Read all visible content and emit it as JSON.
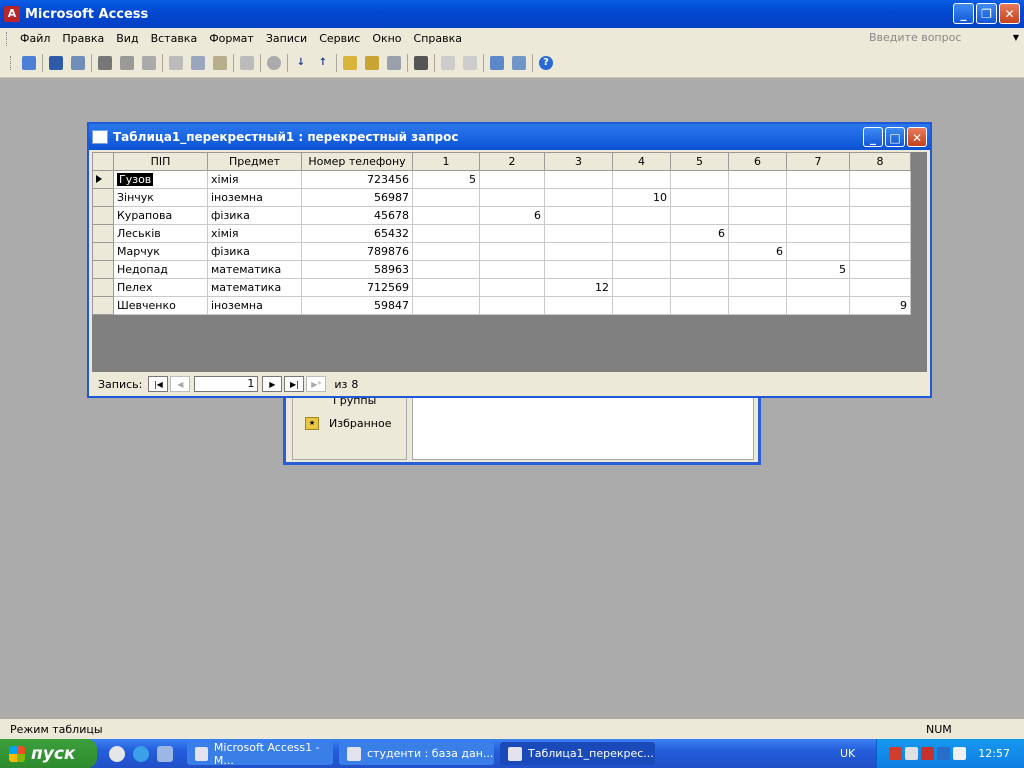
{
  "app": {
    "title": "Microsoft Access"
  },
  "menu": {
    "items": [
      "Файл",
      "Правка",
      "Вид",
      "Вставка",
      "Формат",
      "Записи",
      "Сервис",
      "Окно",
      "Справка"
    ],
    "search_placeholder": "Введите вопрос"
  },
  "toolbar": {
    "icons": [
      "design-view-icon",
      "save-icon",
      "search-icon",
      "print-icon",
      "print-preview-icon",
      "spelling-icon",
      "cut-icon",
      "copy-icon",
      "paste-icon",
      "undo-icon",
      "hyperlink-icon",
      "sort-ascending-icon",
      "sort-descending-icon",
      "filter-selection-icon",
      "filter-form-icon",
      "apply-filter-icon",
      "find-icon",
      "new-record-icon",
      "delete-record-icon",
      "database-window-icon",
      "new-object-icon",
      "help-icon"
    ]
  },
  "dbwindow": {
    "groups_label": "Группы",
    "favorites_label": "Избранное"
  },
  "query_window": {
    "title": "Таблица1_перекрестный1 : перекрестный запрос",
    "columns": [
      "ПІП",
      "Предмет",
      "Номер телефону",
      "1",
      "2",
      "3",
      "4",
      "5",
      "6",
      "7",
      "8"
    ],
    "rows": [
      {
        "name": "Гузов",
        "subject": "хімія",
        "phone": "723456",
        "scores": [
          "5",
          "",
          "",
          "",
          "",
          "",
          "",
          ""
        ]
      },
      {
        "name": "Зінчук",
        "subject": "іноземна",
        "phone": "56987",
        "scores": [
          "",
          "",
          "",
          "10",
          "",
          "",
          "",
          ""
        ]
      },
      {
        "name": "Курапова",
        "subject": "фізика",
        "phone": "45678",
        "scores": [
          "",
          "6",
          "",
          "",
          "",
          "",
          "",
          ""
        ]
      },
      {
        "name": "Леськів",
        "subject": "хімія",
        "phone": "65432",
        "scores": [
          "",
          "",
          "",
          "",
          "6",
          "",
          "",
          ""
        ]
      },
      {
        "name": "Марчук",
        "subject": "фізика",
        "phone": "789876",
        "scores": [
          "",
          "",
          "",
          "",
          "",
          "6",
          "",
          ""
        ]
      },
      {
        "name": "Недопад",
        "subject": "математика",
        "phone": "58963",
        "scores": [
          "",
          "",
          "",
          "",
          "",
          "",
          "5",
          ""
        ]
      },
      {
        "name": "Пелех",
        "subject": "математика",
        "phone": "712569",
        "scores": [
          "",
          "",
          "12",
          "",
          "",
          "",
          "",
          ""
        ]
      },
      {
        "name": "Шевченко",
        "subject": "іноземна",
        "phone": "59847",
        "scores": [
          "",
          "",
          "",
          "",
          "",
          "",
          "",
          "9"
        ]
      }
    ],
    "nav": {
      "label": "Запись:",
      "current": "1",
      "of_label": "из",
      "total": "8"
    }
  },
  "status": {
    "mode": "Режим таблицы",
    "num": "NUM"
  },
  "taskbar": {
    "start": "пуск",
    "buttons": [
      {
        "label": "Microsoft Access1 - М...",
        "active": false
      },
      {
        "label": "студенти : база дан...",
        "active": false
      },
      {
        "label": "Таблица1_перекрес...",
        "active": true
      }
    ],
    "lang": "UK",
    "clock": "12:57"
  },
  "colors": {
    "titlebar": "#0348d0",
    "taskbar": "#245ddb",
    "start": "#2d8b2d",
    "workspace": "#ababab"
  }
}
